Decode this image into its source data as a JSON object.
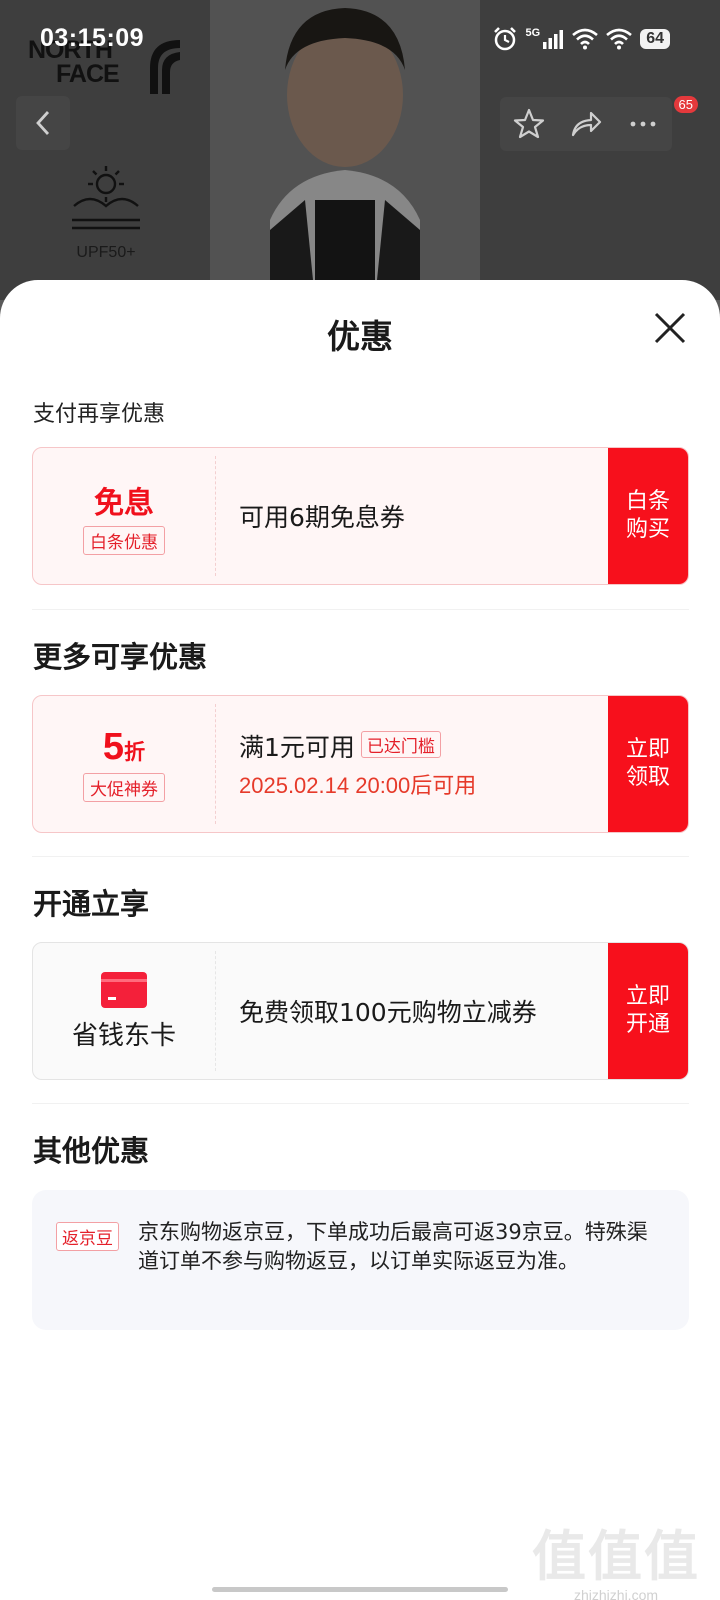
{
  "status_bar": {
    "time": "03:15:09",
    "network": "5G",
    "battery": "64",
    "icons": [
      "alarm-icon",
      "signal-icon",
      "wifi-icon",
      "wifi-icon"
    ]
  },
  "product_bg": {
    "brand_line1": "NORTH",
    "brand_line2": "FACE",
    "upf_label": "UPF50+",
    "cart_count": "65"
  },
  "sheet": {
    "title": "优惠",
    "sections": {
      "payment": {
        "title": "支付再享优惠",
        "card": {
          "main": "免息",
          "tag": "白条优惠",
          "text": "可用6期免息券",
          "action_line1": "白条",
          "action_line2": "购买"
        }
      },
      "more": {
        "title": "更多可享优惠",
        "card": {
          "discount_value": "5",
          "discount_unit": "折",
          "tag": "大促神券",
          "text": "满1元可用",
          "status_tag": "已达门槛",
          "sub": "2025.02.14 20:00后可用",
          "action_line1": "立即",
          "action_line2": "领取"
        }
      },
      "open": {
        "title": "开通立享",
        "card": {
          "name": "省钱东卡",
          "text": "免费领取100元购物立减券",
          "action_line1": "立即",
          "action_line2": "开通"
        }
      },
      "other": {
        "title": "其他优惠",
        "tag": "返京豆",
        "text": "京东购物返京豆，下单成功后最高可返39京豆。特殊渠道订单不参与购物返豆，以订单实际返豆为准。"
      }
    }
  },
  "watermark": {
    "main": "值值值",
    "sub": "zhizhizhi.com"
  },
  "colors": {
    "accent_red": "#f7101c",
    "card_bg": "#fff6f6"
  }
}
